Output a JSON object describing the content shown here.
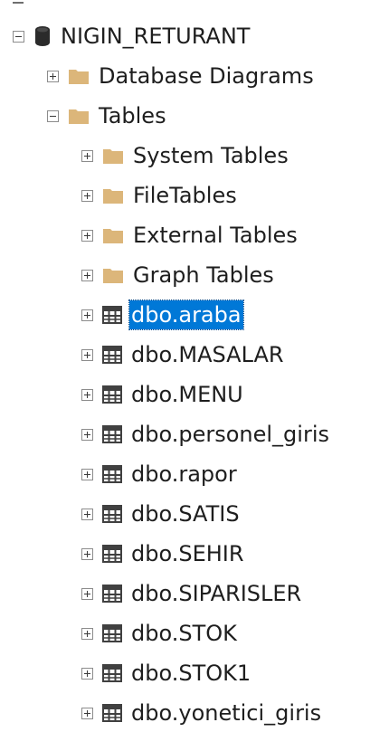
{
  "tree": {
    "database": {
      "label": "NIGIN_RETURANT",
      "expanded": true,
      "icon": "database-icon"
    },
    "database_diagrams": {
      "label": "Database Diagrams",
      "expanded": false,
      "icon": "folder-icon"
    },
    "tables": {
      "label": "Tables",
      "expanded": true,
      "icon": "folder-icon"
    },
    "folders": [
      {
        "label": "System Tables",
        "icon": "folder-icon"
      },
      {
        "label": "FileTables",
        "icon": "folder-icon"
      },
      {
        "label": "External Tables",
        "icon": "folder-icon"
      },
      {
        "label": "Graph Tables",
        "icon": "folder-icon"
      }
    ],
    "table_items": [
      {
        "label": "dbo.araba",
        "selected": true,
        "icon": "table-icon"
      },
      {
        "label": "dbo.MASALAR",
        "icon": "table-icon"
      },
      {
        "label": "dbo.MENU",
        "icon": "table-icon"
      },
      {
        "label": "dbo.personel_giris",
        "icon": "table-icon"
      },
      {
        "label": "dbo.rapor",
        "icon": "table-icon"
      },
      {
        "label": "dbo.SATIS",
        "icon": "table-icon"
      },
      {
        "label": "dbo.SEHIR",
        "icon": "table-icon"
      },
      {
        "label": "dbo.SIPARISLER",
        "icon": "table-icon"
      },
      {
        "label": "dbo.STOK",
        "icon": "table-icon"
      },
      {
        "label": "dbo.STOK1",
        "icon": "table-icon"
      },
      {
        "label": "dbo.yonetici_giris",
        "icon": "table-icon"
      }
    ]
  },
  "colors": {
    "folder": "#dcb67a",
    "selection": "#0078d7",
    "database": "#2b2b2b",
    "table": "#404040"
  }
}
